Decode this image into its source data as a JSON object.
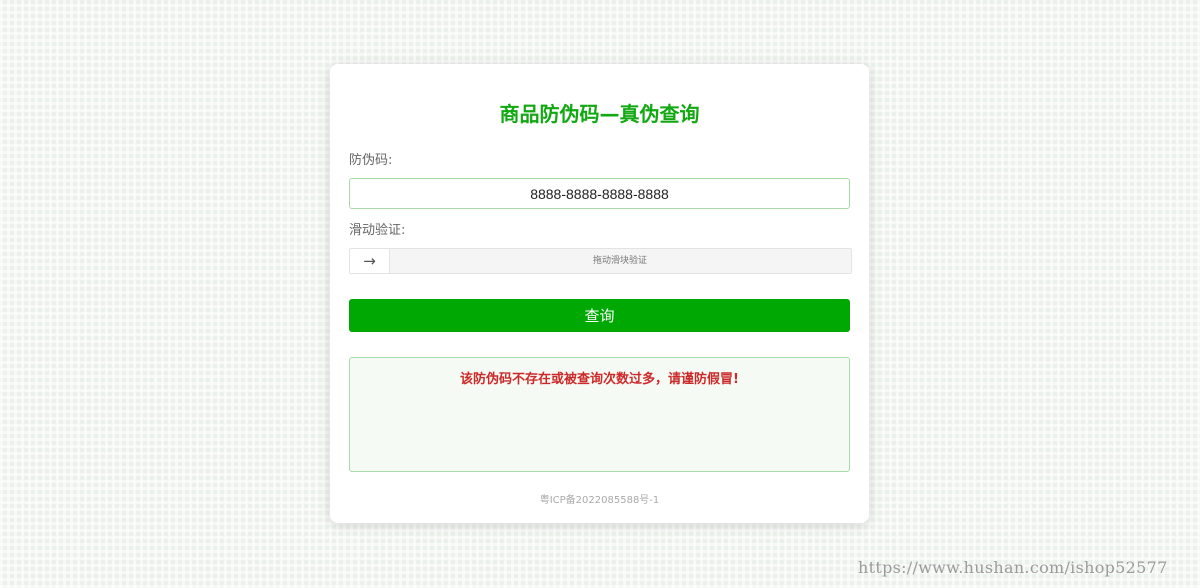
{
  "page": {
    "title": "商品防伪码—真伪查询"
  },
  "form": {
    "code_label": "防伪码:",
    "code_value": "8888-8888-8888-8888",
    "slide_label": "滑动验证:",
    "slide_handle_glyph": "→",
    "slide_hint": "拖动滑块验证",
    "query_button": "查询"
  },
  "result": {
    "message": "该防伪码不存在或被查询次数过多，请谨防假冒!"
  },
  "footer": {
    "icp": "粤ICP备2022085588号-1"
  },
  "watermark": {
    "text": "https://www.hushan.com/ishop52577"
  },
  "colors": {
    "accent_green": "#12a812",
    "button_green": "#00a803",
    "error_red": "#cc2a2a"
  }
}
